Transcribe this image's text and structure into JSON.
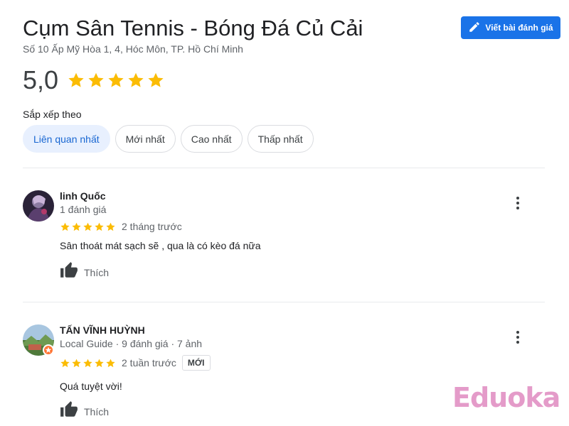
{
  "place": {
    "title": "Cụm Sân Tennis - Bóng Đá Củ Cải",
    "address": "Số 10 Ấp Mỹ Hòa 1, 4, Hóc Môn, TP. Hồ Chí Minh",
    "rating": "5,0",
    "rating_stars": 5
  },
  "write_review_label": "Viết bài đánh giá",
  "sort": {
    "label": "Sắp xếp theo",
    "options": [
      "Liên quan nhất",
      "Mới nhất",
      "Cao nhất",
      "Thấp nhất"
    ],
    "selected": "Liên quan nhất"
  },
  "reviews": [
    {
      "name": "linh Quốc",
      "meta": "1 đánh giá",
      "stars": 5,
      "time": "2 tháng trước",
      "badge": "",
      "text": "Sân thoát mát sạch sẽ , qua là có kèo đá nữa",
      "like_label": "Thích"
    },
    {
      "name": "TẤN VĨNH HUỲNH",
      "meta": "Local Guide · 9 đánh giá · 7 ảnh",
      "stars": 5,
      "time": "2 tuần trước",
      "badge": "MỚI",
      "text": "Quá tuyệt vời!",
      "like_label": "Thích"
    }
  ],
  "watermark": "Eduoka",
  "colors": {
    "accent_blue": "#1a73e8",
    "star_yellow": "#fbbc04",
    "chip_active_bg": "#e8f0fe",
    "watermark_pink": "#e49bc9"
  },
  "icons": {
    "write_button": "pencil-icon",
    "like_button": "thumbs-up-icon",
    "more_menu": "more-vertical-icon"
  }
}
